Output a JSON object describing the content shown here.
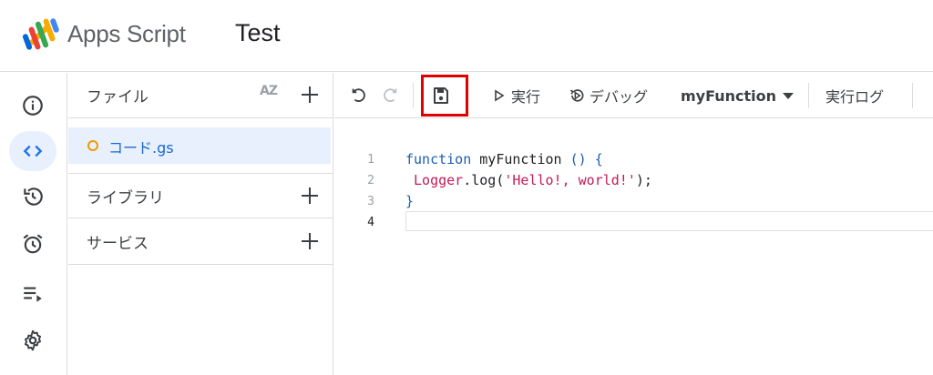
{
  "header": {
    "brand": "Apps Script",
    "project_name": "Test",
    "logo_icon": "apps-script-logo"
  },
  "rail": {
    "items": [
      {
        "name": "overview",
        "icon": "info-icon",
        "active": false
      },
      {
        "name": "editor",
        "icon": "code-icon",
        "active": true
      },
      {
        "name": "executions-history",
        "icon": "history-icon",
        "active": false
      },
      {
        "name": "triggers",
        "icon": "alarm-icon",
        "active": false
      },
      {
        "name": "executions",
        "icon": "playlist-play-icon",
        "active": false
      },
      {
        "name": "settings",
        "icon": "gear-icon",
        "active": false
      }
    ]
  },
  "files_panel": {
    "files_title": "ファイル",
    "sort_label": "AZ",
    "files": [
      {
        "name": "コード.gs"
      }
    ],
    "libraries_title": "ライブラリ",
    "services_title": "サービス"
  },
  "toolbar": {
    "run_label": "実行",
    "debug_label": "デバッグ",
    "function_select": "myFunction",
    "log_label": "実行ログ"
  },
  "editor": {
    "line_numbers": [
      "1",
      "2",
      "3",
      "4"
    ],
    "lines": {
      "l1_kw": "function",
      "l1_fn": " myFunction",
      "l1_br": "() {",
      "l2_obj": " Logger",
      "l2_dot": ".log(",
      "l2_str": "'Hello!, world!'",
      "l2_end": ");",
      "l3": "}"
    }
  },
  "colors": {
    "accent": "#1a73e8",
    "highlight_box": "#e00000",
    "active_bg": "#e8f0fe"
  }
}
